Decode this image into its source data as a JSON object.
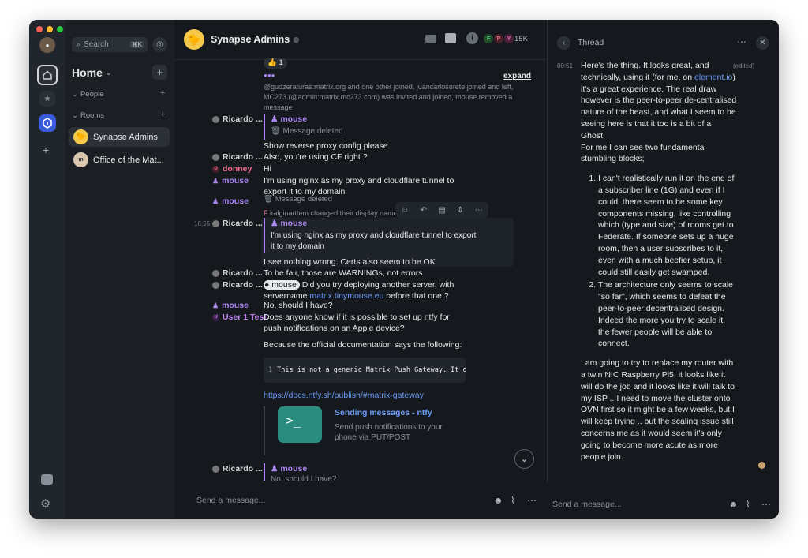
{
  "sidebar": {
    "search_placeholder": "Search",
    "search_shortcut": "⌘K",
    "home_label": "Home",
    "sections": {
      "people": "People",
      "rooms": "Rooms"
    },
    "rooms": [
      {
        "name": "Synapse Admins"
      },
      {
        "name": "Office of the Mat..."
      }
    ]
  },
  "room": {
    "name": "Synapse Admins",
    "member_count": "15K",
    "member_initials": [
      "F",
      "P",
      "Y"
    ]
  },
  "timeline": {
    "reaction": "👍 1",
    "expand_label": "expand",
    "membership_summary": "@gudzeraturas:matrix.org and one other joined, juancarlosorete joined and left, MC273 (@admin:matrix.mc273.com) was invited and joined, mouse removed a message",
    "deleted_label": "Message deleted",
    "display_name_change": "kalginarttem changed their display name",
    "messages": [
      {
        "sender": "Ricardo ...",
        "reply_to": "mouse",
        "text": "Show reverse proxy config please"
      },
      {
        "sender": "Ricardo ...",
        "text": "Also, you're using CF right ?"
      },
      {
        "sender": "donney",
        "initial": "D",
        "text": "Hi"
      },
      {
        "sender": "mouse",
        "text": "I'm using nginx as my proxy and cloudflare tunnel to export it to my domain"
      },
      {
        "sender": "mouse",
        "text": ""
      },
      {
        "time": "16:55",
        "sender": "Ricardo ...",
        "reply_to": "mouse",
        "quoted": "I'm using nginx as my proxy and cloudflare tunnel to export it to my domain",
        "text": "I see nothing wrong. Certs also seem to be OK"
      },
      {
        "sender": "Ricardo ...",
        "text": "To be fair, those are WARNINGs, not errors"
      },
      {
        "sender": "Ricardo ...",
        "pill": "mouse",
        "text_a": " Did you try deploying another server, with servername ",
        "link": "matrix.tinymouse.eu",
        "text_b": " before that one ?"
      },
      {
        "sender": "mouse",
        "text": "No, should I have?"
      },
      {
        "sender": "User 1 Test",
        "initial": "U",
        "text": "Does anyone know if it is possible to set up ntfy for push notifications on an Apple device?",
        "text2": "Because the official documentation says the following:",
        "code_line": "1",
        "code": "This is not a generic Matrix Push Gateway. It onl",
        "url": "https://docs.ntfy.sh/publish/#matrix-gateway",
        "preview_title": "Sending messages - ntfy",
        "preview_desc": "Send push notifications to your phone via PUT/POST"
      },
      {
        "sender": "Ricardo ...",
        "reply_to": "mouse",
        "quoted": "No, should I have?"
      }
    ],
    "composer_placeholder": "Send a message..."
  },
  "thread": {
    "title": "Thread",
    "time": "00:51",
    "edited": "(edited)",
    "para1_a": "Here's the thing. It looks great, and technically, using it (for me, on ",
    "para1_link": "element.io",
    "para1_b": ") it's a great experience. The real draw however is the peer-to-peer de-centralised nature of the beast, and what I seem to be seeing here is that it too is a bit of a Ghost.",
    "para2": "For me I can see two fundamental stumbling blocks;",
    "items": [
      "I can't realistically run it on the end of a subscriber line (1G) and even if I could, there seem to be some key components missing, like controlling which (type and size) of rooms get to Federate. If someone sets up a huge room, then a user subscribes to it, even with a much beefier setup, it could still easily get swamped.",
      "The architecture only seems to scale \"so far\", which seems to defeat the peer-to-peer decentralised design. Indeed the more you try to scale it, the fewer people will be able to connect."
    ],
    "para3": "I am going to try to replace my router with a twin NIC Raspberry Pi5, it looks like it will do the job and it looks like it will talk to my ISP .. I need to move the cluster onto OVN first so it might be a few weeks, but I will keep trying .. but the scaling issue still concerns me as it would seem it's only going to become more acute as more people join.",
    "composer_placeholder": "Send a message..."
  },
  "colors": {
    "accent": "#a986f0",
    "link": "#6c9cf5",
    "bg": "#15191e"
  }
}
